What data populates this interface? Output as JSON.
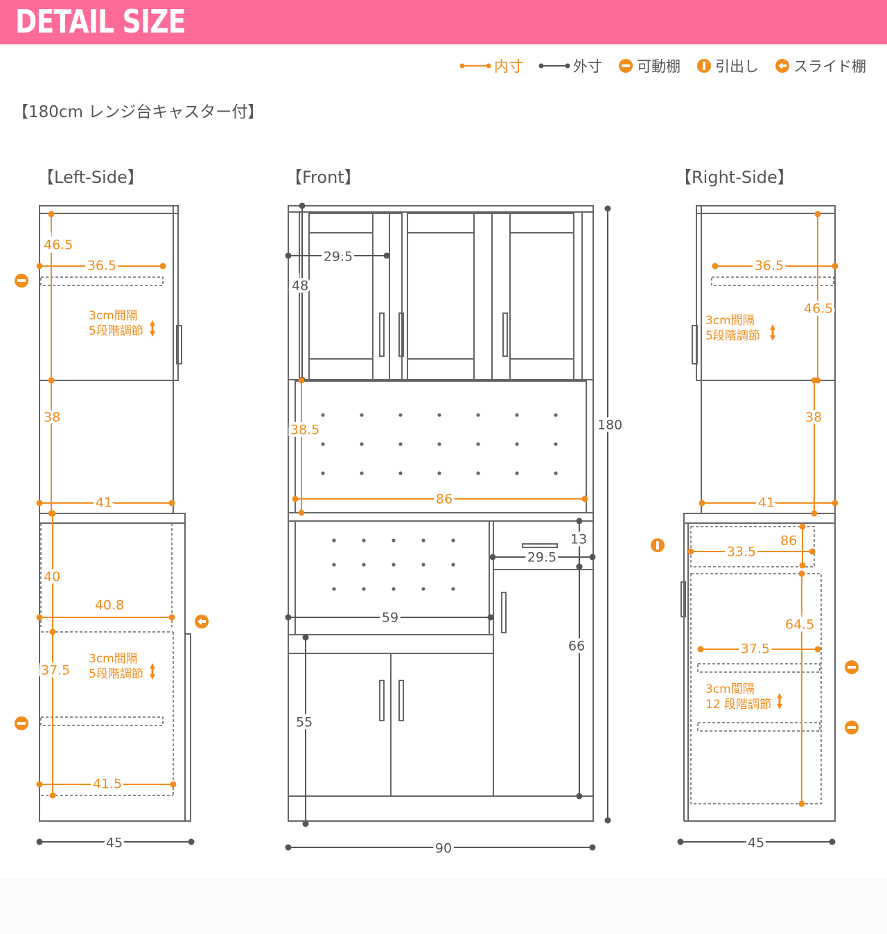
{
  "banner": {
    "title": "DETAIL SIZE"
  },
  "legend": {
    "inner_label": "内寸",
    "outer_label": "外寸",
    "movable_shelf_label": "可動棚",
    "drawer_label": "引出し",
    "slide_shelf_label": "スライド棚"
  },
  "subtitle": "【180cm レンジ台キャスター付】",
  "views": {
    "left_title": "【Left-Side】",
    "front_title": "【Front】",
    "right_title": "【Right-Side】"
  },
  "colors": {
    "accent": "#f28c1c",
    "line": "#666666",
    "banner": "#ff6b98"
  },
  "left": {
    "h_top": "46.5",
    "d_top_shelf": "36.5",
    "note_top": "3cm間隔",
    "note_top2": "5段階調節",
    "h_mid": "38",
    "d_mid": "41",
    "h_lower": "40",
    "d_slide": "40.8",
    "h_bottom": "37.5",
    "note_bottom": "3cm間隔",
    "note_bottom2": "5段階調節",
    "d_bottom": "41.5",
    "outer_depth": "45"
  },
  "front": {
    "w_glass": "29.5",
    "h_upper": "48",
    "h_range": "38.5",
    "w_range": "86",
    "h_drawer": "13",
    "w_drawer": "29.5",
    "w_open": "59",
    "h_door_right": "66",
    "h_lower_left": "55",
    "total_height": "180",
    "total_width": "90"
  },
  "right": {
    "d_top_shelf": "36.5",
    "h_top": "46.5",
    "note_top": "3cm間隔",
    "note_top2": "5段階調節",
    "h_mid": "38",
    "d_mid": "41",
    "d_drawer": "33.5",
    "h_drawer": "86",
    "h_cabinet": "64.5",
    "d_cabinet_shelf": "37.5",
    "note_bottom": "3cm間隔",
    "note_bottom2": "12 段階調節",
    "outer_depth": "45"
  }
}
